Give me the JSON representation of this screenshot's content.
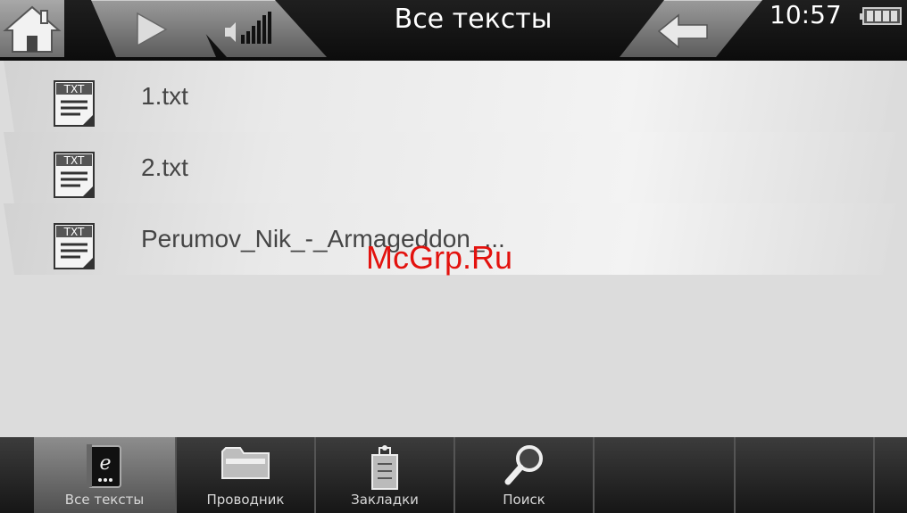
{
  "header": {
    "title": "Все тексты",
    "time": "10:57"
  },
  "files": [
    {
      "name": "1.txt",
      "icon": "txt-file-icon"
    },
    {
      "name": "2.txt",
      "icon": "txt-file-icon"
    },
    {
      "name": "Perumov_Nik_-_Armageddon_...",
      "icon": "txt-file-icon"
    }
  ],
  "file_icon_label": "TXT",
  "watermark": "McGrp.Ru",
  "tabs": [
    {
      "label": "Все тексты",
      "icon": "ebook-icon",
      "active": true
    },
    {
      "label": "Проводник",
      "icon": "folder-icon",
      "active": false
    },
    {
      "label": "Закладки",
      "icon": "bookmark-icon",
      "active": false
    },
    {
      "label": "Поиск",
      "icon": "search-icon",
      "active": false
    }
  ],
  "colors": {
    "watermark": "#e3120e",
    "topbar": "#111111",
    "bottombar": "#2a2a2a"
  }
}
